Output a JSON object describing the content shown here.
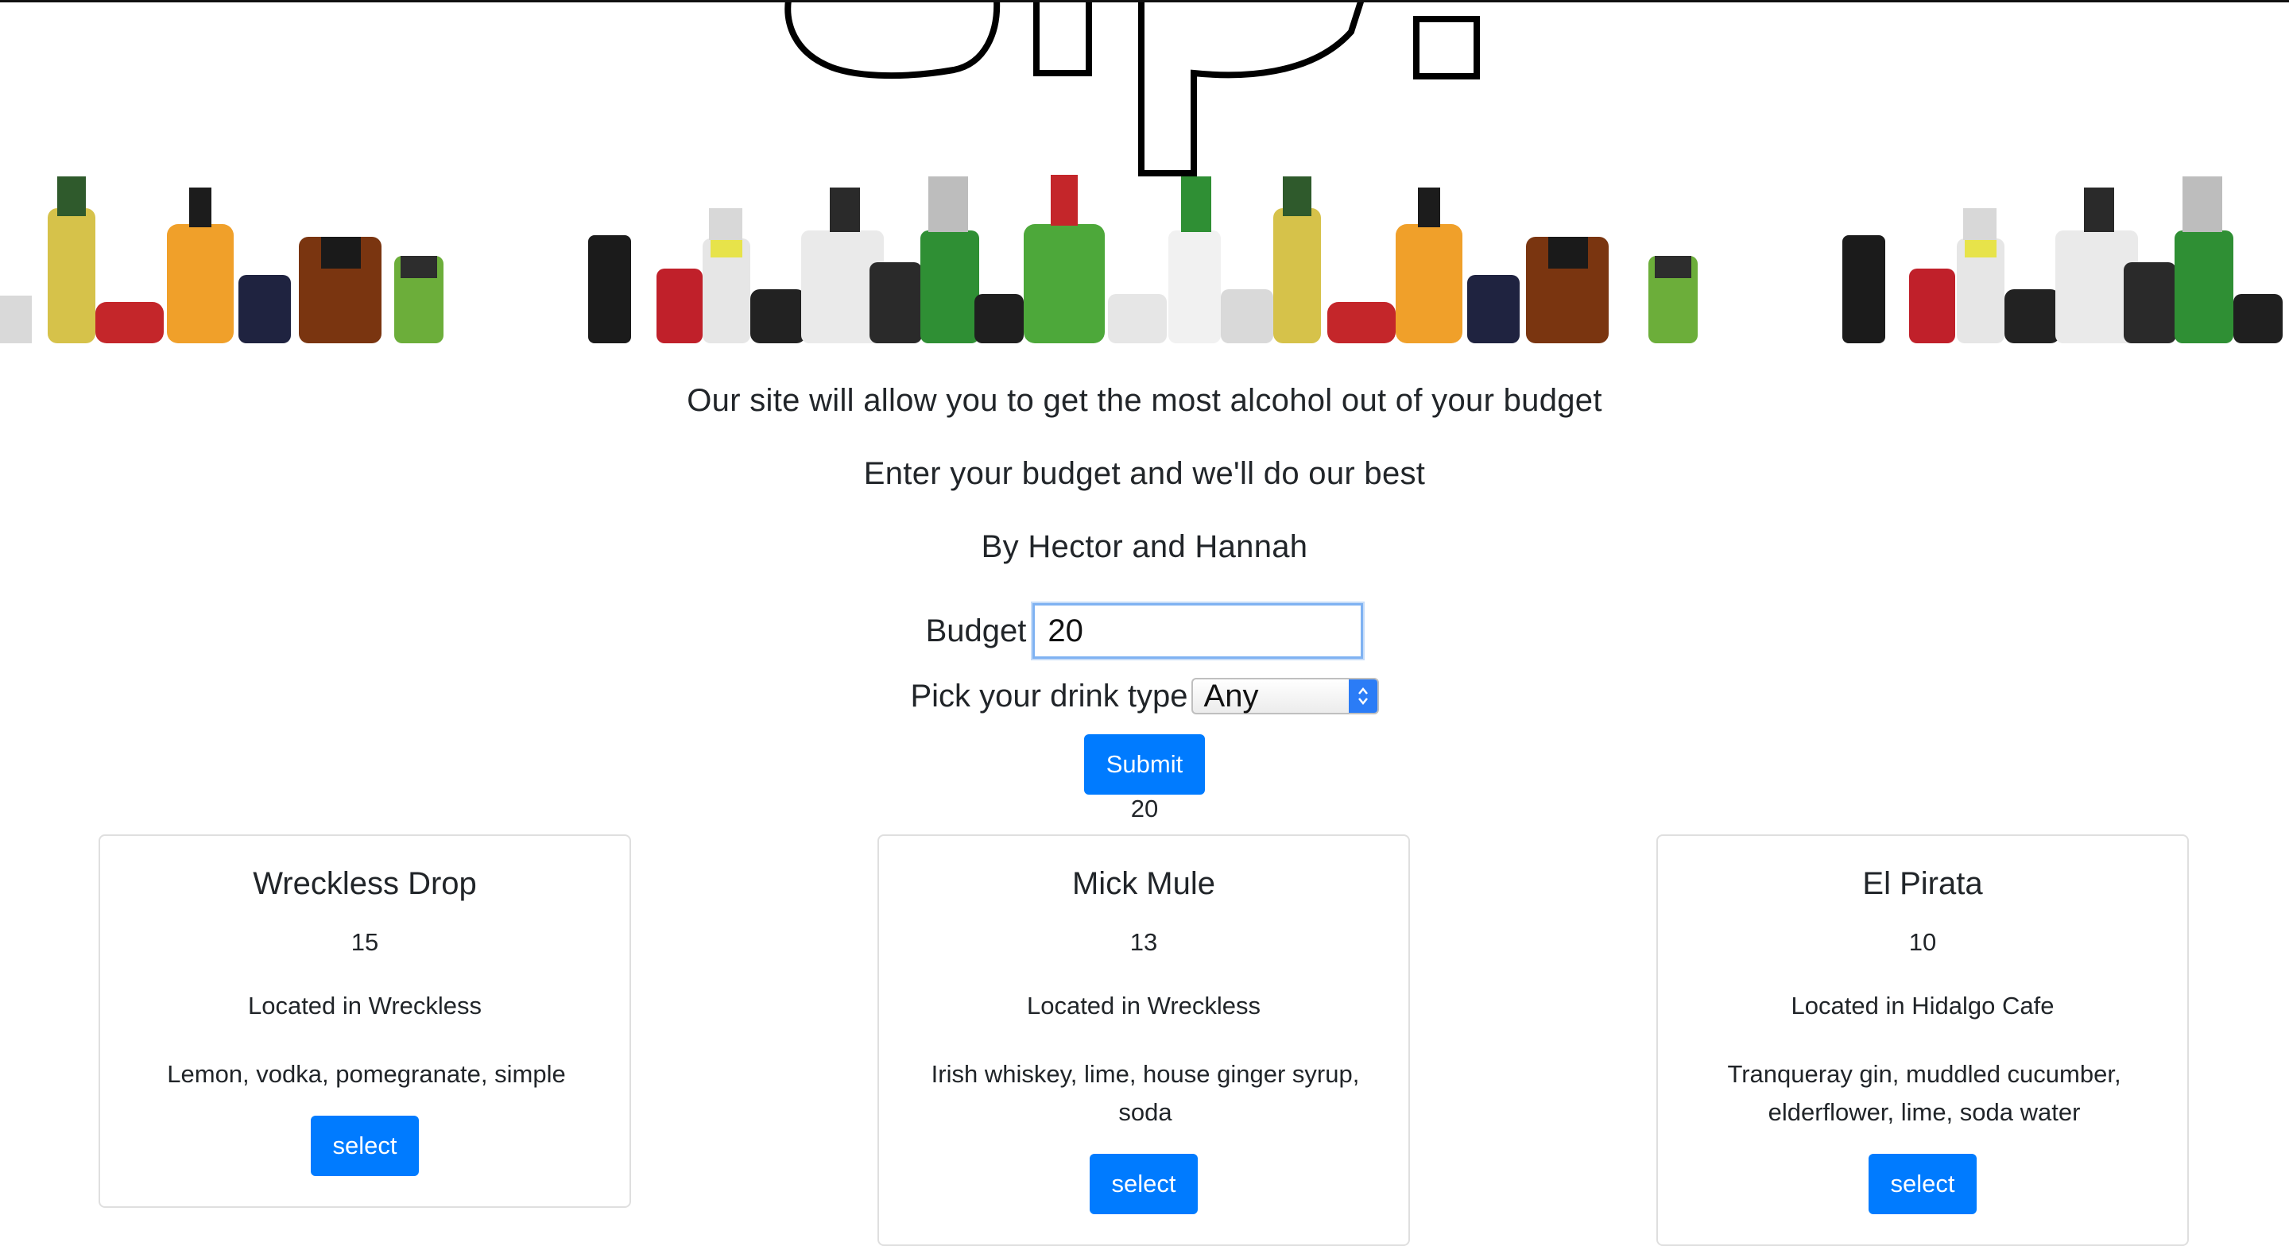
{
  "tagline": {
    "line1": "Our site will allow you to get the most alcohol out of your budget",
    "line2": "Enter your budget and we'll do our best",
    "line3": "By Hector and Hannah"
  },
  "form": {
    "budget_label": "Budget",
    "budget_value": "20",
    "drink_type_label": "Pick your drink type",
    "drink_type_value": "Any",
    "submit_label": "Submit"
  },
  "result_value": "20",
  "cards": [
    {
      "name": "Wreckless Drop",
      "price": "15",
      "location": "Located in Wreckless",
      "ingredients": "Lemon, vodka, pomegranate, simple",
      "button": "select"
    },
    {
      "name": "Mick Mule",
      "price": "13",
      "location": "Located in Wreckless",
      "ingredients": "Irish whiskey, lime, house ginger syrup, soda",
      "button": "select"
    },
    {
      "name": "El Pirata",
      "price": "10",
      "location": "Located in Hidalgo Cafe",
      "ingredients": "Tranqueray gin, muddled cucumber, elderflower, lime, soda water",
      "button": "select"
    }
  ],
  "colors": {
    "button": "#007bff",
    "input_focus": "#7fb2f2",
    "card_border": "#dfdfdf"
  }
}
